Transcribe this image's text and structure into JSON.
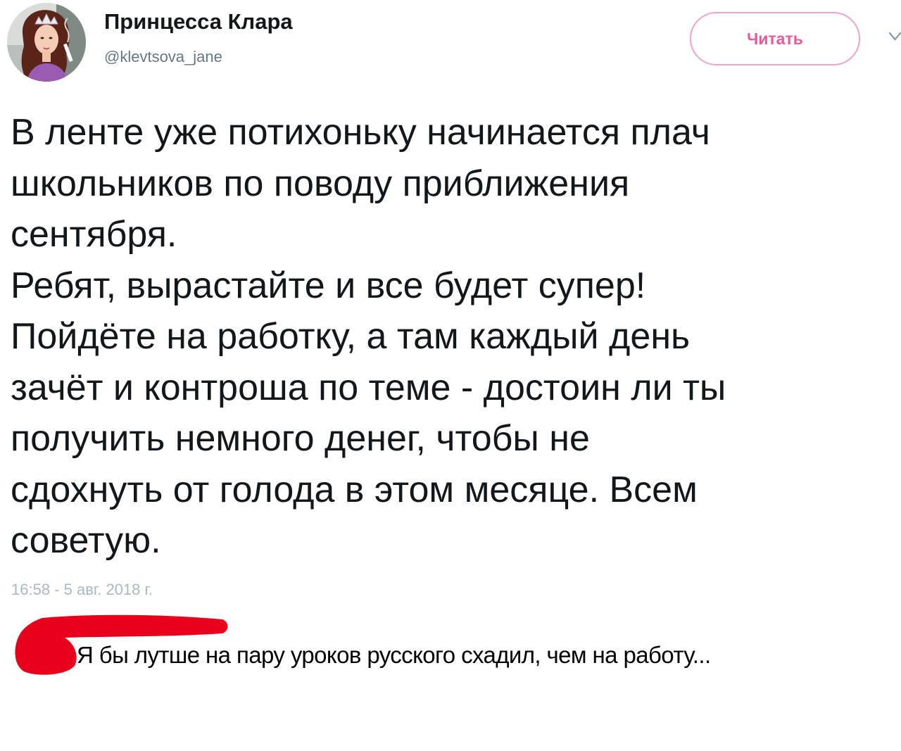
{
  "tweet": {
    "author": {
      "display_name": "Принцесса Клара",
      "handle": "@klevtsova_jane",
      "avatar_icon": "avatar-portrait-icon"
    },
    "follow_button_label": "Читать",
    "menu_icon": "chevron-down-icon",
    "text_lines": [
      "В ленте уже потихоньку начинается плач",
      "школьников по поводу приближения",
      "сентября.",
      "Ребят, вырастайте и все будет супер!",
      "Пойдёте на работку, а там каждый день",
      "зачёт и контроша по теме - достоин ли ты",
      "получить немного денег, чтобы не",
      "сдохнуть от голода в этом месяце. Всем",
      "советую."
    ],
    "timestamp": "16:58 - 5 авг. 2018 г."
  },
  "comment": {
    "text": "Я бы лутше на пару уроков русского схадил, чем на работу...",
    "redaction_color": "#e8001c"
  },
  "colors": {
    "text": "#14171a",
    "secondary": "#657786",
    "follow_accent": "#e85a98",
    "follow_border": "#f2a3c5"
  }
}
